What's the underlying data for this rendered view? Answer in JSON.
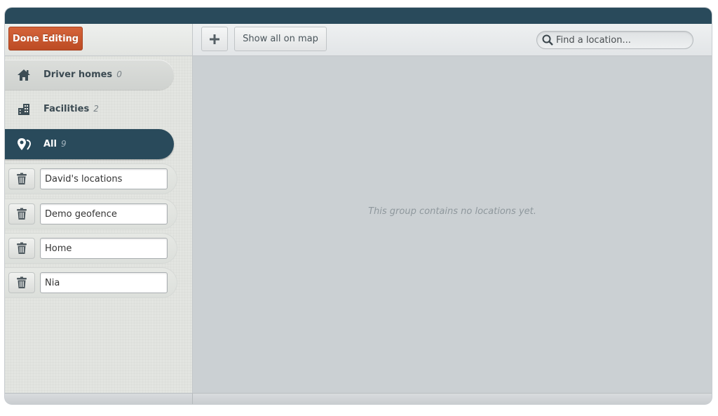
{
  "sidebar": {
    "done_label": "Done Editing",
    "groups": [
      {
        "label": "Driver homes",
        "count": "0",
        "icon": "house-icon",
        "state": "hover"
      },
      {
        "label": "Facilities",
        "count": "2",
        "icon": "buildings-icon",
        "state": "normal"
      },
      {
        "label": "All",
        "count": "9",
        "icon": "map-pins-icon",
        "state": "selected"
      }
    ],
    "editable_groups": [
      {
        "name": "David's locations",
        "icon": "trash-icon"
      },
      {
        "name": "Demo geofence",
        "icon": "trash-icon"
      },
      {
        "name": "Home",
        "icon": "trash-icon"
      },
      {
        "name": "Nia",
        "icon": "trash-icon"
      }
    ]
  },
  "toolbar": {
    "add_icon": "plus-icon",
    "show_all_label": "Show all on map",
    "search_placeholder": "Find a location...",
    "search_icon": "search-icon"
  },
  "main": {
    "empty_message": "This group contains no locations yet."
  },
  "colors": {
    "header": "#294a5b",
    "accent": "#c9552c",
    "selected": "#294a5b"
  }
}
